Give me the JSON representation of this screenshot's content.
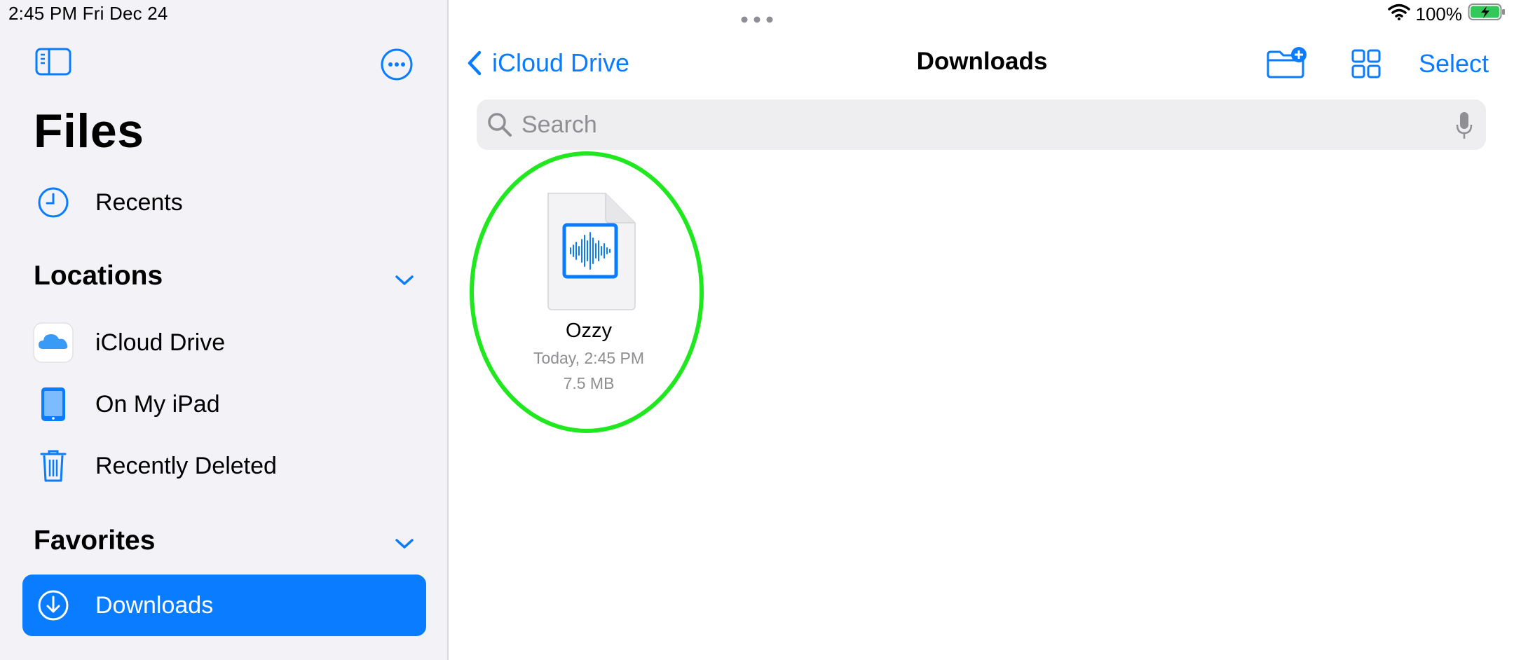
{
  "status_bar": {
    "time_date": "2:45 PM   Fri Dec 24",
    "battery_percent": "100%",
    "wifi_icon": "wifi-icon",
    "battery_icon": "battery-charging-icon"
  },
  "sidebar": {
    "title": "Files",
    "toggle_icon": "sidebar-toggle-icon",
    "more_icon": "ellipsis-circle-icon",
    "recents_label": "Recents",
    "locations_header": "Locations",
    "locations": [
      {
        "label": "iCloud Drive",
        "icon": "icloud-icon"
      },
      {
        "label": "On My iPad",
        "icon": "ipad-icon"
      },
      {
        "label": "Recently Deleted",
        "icon": "trash-icon"
      }
    ],
    "favorites_header": "Favorites",
    "favorites": [
      {
        "label": "Downloads",
        "icon": "download-circle-icon",
        "selected": true
      }
    ]
  },
  "nav": {
    "back_label": "iCloud Drive",
    "title": "Downloads",
    "select_label": "Select"
  },
  "search": {
    "placeholder": "Search"
  },
  "files": [
    {
      "name": "Ozzy",
      "date": "Today, 2:45 PM",
      "size": "7.5 MB",
      "icon": "audio-waveform-icon"
    }
  ],
  "colors": {
    "accent": "#0a7cff",
    "highlight_ring": "#1fe81f",
    "sidebar_bg": "#f2f2f7"
  }
}
